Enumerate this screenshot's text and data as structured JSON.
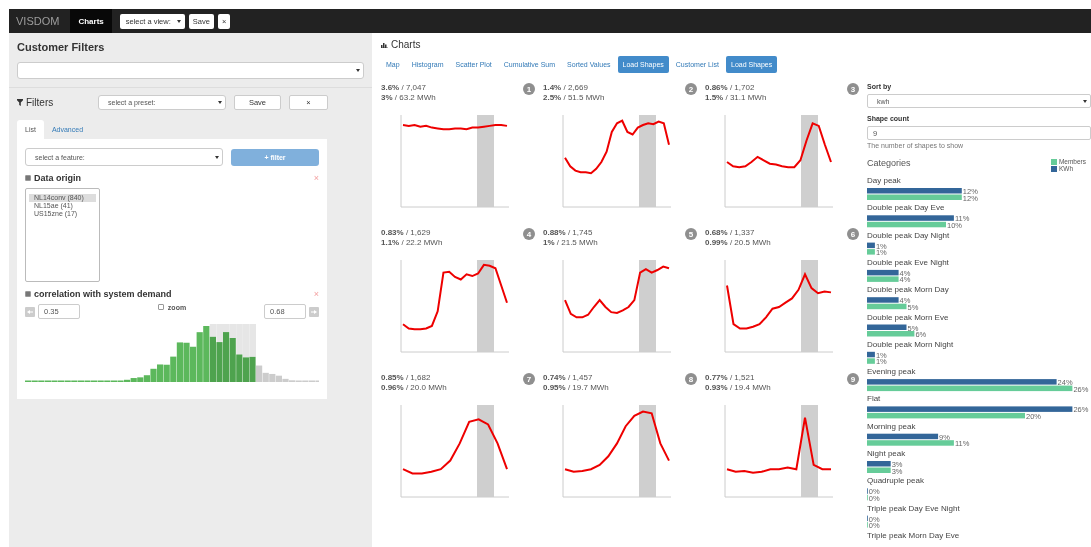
{
  "nav": {
    "brand": "VISDOM",
    "items": [
      {
        "label": "Charts",
        "selected": true
      }
    ],
    "view_select": "select a view:",
    "buttons": [
      "Save",
      "×"
    ]
  },
  "filters_panel": {
    "title": "Customer Filters",
    "heading": "Filters",
    "preset_select": "select a preset:",
    "buttons": [
      "Save",
      "×"
    ],
    "tabs": [
      {
        "label": "List",
        "selected": true
      },
      {
        "label": "Advanced",
        "selected": false
      }
    ],
    "feature_select": "select a feature:",
    "add_button": "+ filter",
    "filters": [
      {
        "kind": "list",
        "label": "Data origin",
        "checked": true,
        "remove": "×",
        "options": [
          {
            "label": "NL14conv (840)",
            "selected": true
          },
          {
            "label": "NL15ae (41)",
            "selected": false
          },
          {
            "label": "US15zne (17)",
            "selected": false
          }
        ]
      },
      {
        "kind": "range",
        "label": "correlation with system demand",
        "checked": true,
        "remove": "×",
        "min": "0.35",
        "max": "0.68",
        "zoom": {
          "label": "zoom",
          "checked": false
        }
      }
    ]
  },
  "charts": {
    "title": "Charts",
    "tabs": [
      {
        "label": "Map",
        "selected": false
      },
      {
        "label": "Histogram",
        "selected": false
      },
      {
        "label": "Scatter Plot",
        "selected": false
      },
      {
        "label": "Cumulative Sum",
        "selected": false
      },
      {
        "label": "Sorted Values",
        "selected": false
      },
      {
        "label": "Load Shapes",
        "selected": true
      },
      {
        "label": "Customer List",
        "selected": false
      },
      {
        "label": "Load Shapes",
        "selected": true
      }
    ],
    "shapes": [
      {
        "number": "1",
        "line_1": "**3.6%** / 7,047",
        "line_2": "**3%** / 63.2 MWh"
      },
      {
        "number": "2",
        "line_1": "**1.4%** / 2,669",
        "line_2": "**2.5%** / 51.5 MWh"
      },
      {
        "number": "3",
        "line_1": "**0.86%** / 1,702",
        "line_2": "**1.5%** / 31.1 MWh"
      },
      {
        "number": "4",
        "line_1": "**0.83%** / 1,629",
        "line_2": "**1.1%** / 22.2 MWh"
      },
      {
        "number": "5",
        "line_1": "**0.88%** / 1,745",
        "line_2": "**1%** / 21.5 MWh"
      },
      {
        "number": "6",
        "line_1": "**0.68%** / 1,337",
        "line_2": "**0.99%** / 20.5 MWh"
      },
      {
        "number": "7",
        "line_1": "**0.85%** / 1,682",
        "line_2": "**0.96%** / 20.0 MWh"
      },
      {
        "number": "8",
        "line_1": "**0.74%** / 1,457",
        "line_2": "**0.95%** / 19.7 MWh"
      },
      {
        "number": "9",
        "line_1": "**0.77%** / 1,521",
        "line_2": "**0.93%** / 19.4 MWh"
      }
    ],
    "sidebar": {
      "sort_label": "Sort by",
      "sort_value": "kwh",
      "count_label": "Shape count",
      "count_value": "9",
      "count_help": "The number of shapes to show",
      "categories_title": "Categories",
      "chart_data": {
        "type": "bar",
        "orientation": "horizontal",
        "categories": [
          "Day peak",
          "Double peak Day Eve",
          "Double peak Day Night",
          "Double peak Eve Night",
          "Double peak Morn Day",
          "Double peak Morn Eve",
          "Double peak Morn Night",
          "Evening peak",
          "Flat",
          "Morning peak",
          "Night peak",
          "Quadruple peak",
          "Triple peak Day Eve Night",
          "Triple peak Morn Day Eve"
        ],
        "series": [
          {
            "name": "KWh",
            "color": "#336699",
            "values": [
              12,
              11,
              1,
              4,
              4,
              5,
              1,
              24,
              26,
              9,
              3,
              0,
              0,
              null
            ],
            "value_labels": [
              "12%",
              "11%",
              "1%",
              "4%",
              "4%",
              "5%",
              "1%",
              "24%",
              "26%",
              "9%",
              "3%",
              "0%",
              "0%",
              null
            ]
          },
          {
            "name": "Members",
            "color": "#66cc99",
            "values": [
              12,
              10,
              1,
              4,
              5,
              6,
              1,
              26,
              20,
              11,
              3,
              0,
              0,
              null
            ],
            "value_labels": [
              "12%",
              "10%",
              "1%",
              "4%",
              "5%",
              "6%",
              "1%",
              "26%",
              "20%",
              "11%",
              "3%",
              "0%",
              "0%",
              null
            ]
          }
        ]
      }
    }
  }
}
